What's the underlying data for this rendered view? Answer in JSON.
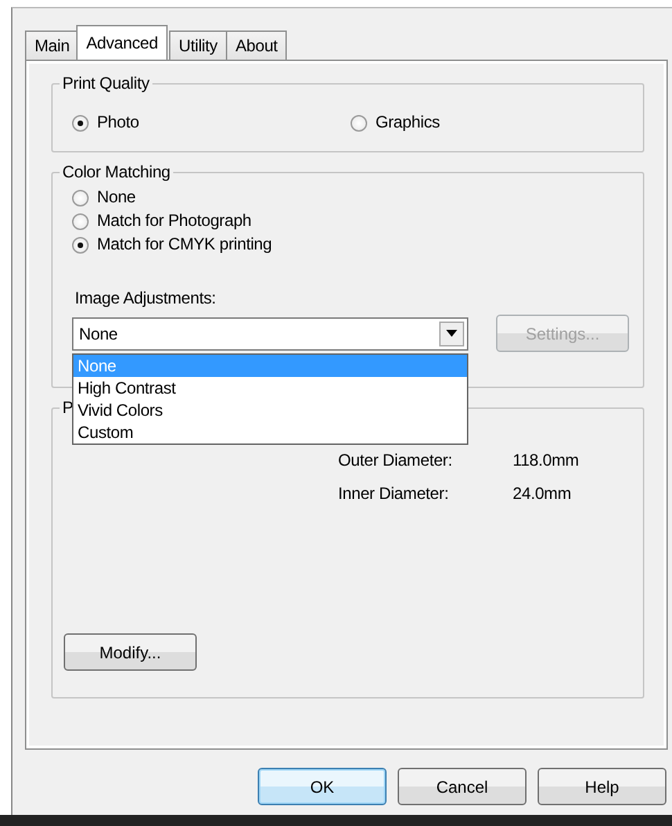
{
  "tabs": [
    {
      "label": "Main",
      "selected": false
    },
    {
      "label": "Advanced",
      "selected": true
    },
    {
      "label": "Utility",
      "selected": false
    },
    {
      "label": "About",
      "selected": false
    }
  ],
  "print_quality": {
    "title": "Print Quality",
    "options": [
      {
        "label": "Photo",
        "selected": true
      },
      {
        "label": "Graphics",
        "selected": false
      }
    ]
  },
  "color_matching": {
    "title": "Color Matching",
    "options": [
      {
        "label": "None",
        "selected": false
      },
      {
        "label": "Match for Photograph",
        "selected": false
      },
      {
        "label": "Match for CMYK printing",
        "selected": true
      }
    ],
    "image_adjustments": {
      "label": "Image Adjustments:",
      "value": "None",
      "expanded": true,
      "options": [
        {
          "label": "None",
          "selected": true
        },
        {
          "label": "High Contrast",
          "selected": false
        },
        {
          "label": "Vivid Colors",
          "selected": false
        },
        {
          "label": "Custom",
          "selected": false
        }
      ]
    },
    "settings_button": {
      "label": "Settings...",
      "disabled": true
    }
  },
  "third_group": {
    "title": "P",
    "fields": [
      {
        "label": "Outer Diameter:",
        "value": "118.0mm"
      },
      {
        "label": "Inner Diameter:",
        "value": "24.0mm"
      }
    ],
    "modify_button": "Modify..."
  },
  "buttons": [
    {
      "label": "OK",
      "default": true
    },
    {
      "label": "Cancel",
      "default": false
    },
    {
      "label": "Help",
      "default": false
    }
  ]
}
